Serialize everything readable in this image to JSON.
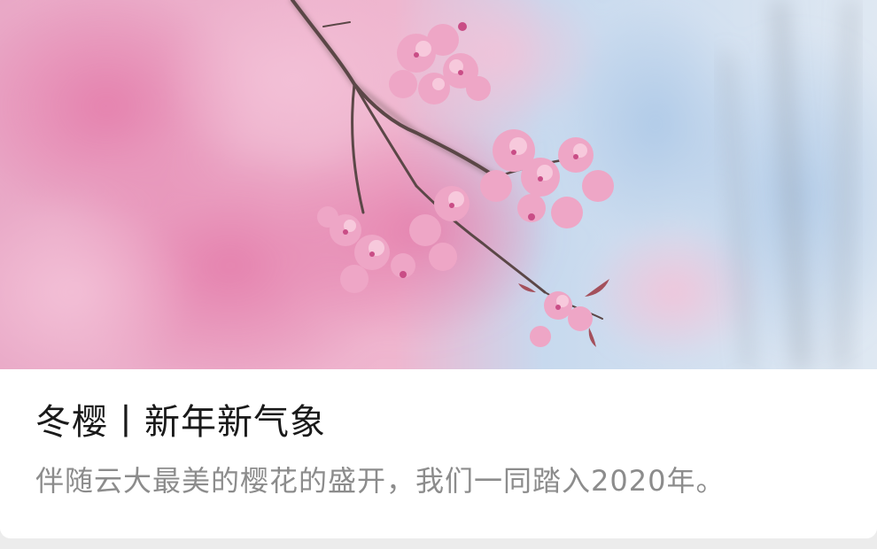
{
  "card": {
    "title": "冬樱丨新年新气象",
    "description": "伴随云大最美的樱花的盛开，我们一同踏入2020年。",
    "image_subject": "cherry-blossom-branch-photo"
  },
  "colors": {
    "sky": "#b9d3ec",
    "blossom": "#ec9fc0",
    "blossom_dark": "#d86a9a",
    "branch": "#5b4747",
    "title": "#1a1a1a",
    "description": "#8c8c8c"
  }
}
